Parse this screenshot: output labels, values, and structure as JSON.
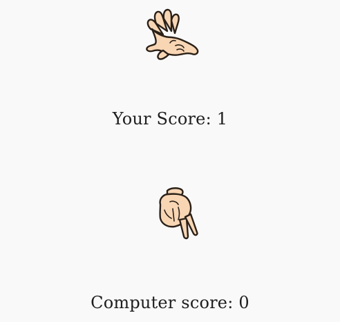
{
  "player": {
    "hand_icon": "paper-hand-icon",
    "score_label": "Your Score:",
    "score_value": "1"
  },
  "computer": {
    "hand_icon": "scissors-hand-icon",
    "score_label": "Computer score:",
    "score_value": "0"
  },
  "colors": {
    "background": "#f9f9f9",
    "skin": "#f8d6b4",
    "outline": "#2a2018",
    "text": "#1e1e1e"
  }
}
